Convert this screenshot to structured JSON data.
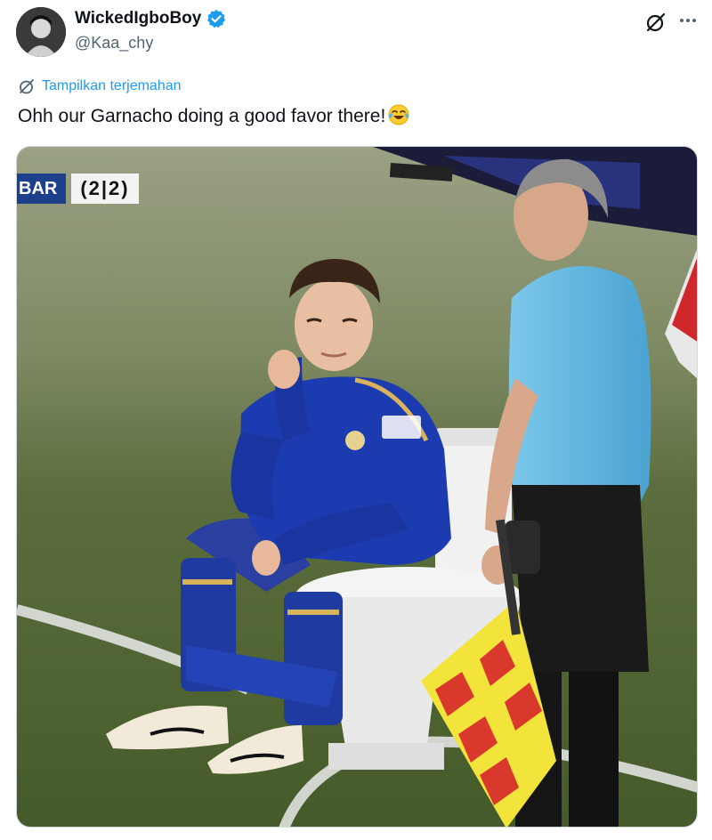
{
  "post": {
    "display_name": "WickedIgboBoy",
    "handle": "@Kaa_chy",
    "translate_label": "Tampilkan terjemahan",
    "text": "Ohh our Garnacho doing a good favor there!"
  },
  "icons": {
    "avatar": "avatar",
    "verified": "verified-badge-icon",
    "grok": "grok-icon",
    "more": "more-icon",
    "translate": "translate-icon",
    "emoji": "tears-of-joy-emoji"
  },
  "media": {
    "scoreboard": {
      "team": "BAR",
      "score": "(2|2)"
    }
  },
  "colors": {
    "accent": "#1d9bf0",
    "text": "#0f1419",
    "muted": "#536471"
  }
}
